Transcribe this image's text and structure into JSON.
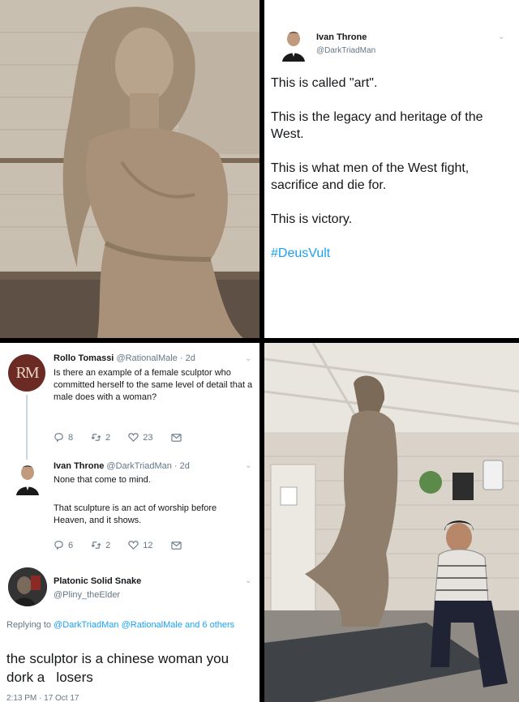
{
  "top_tweet": {
    "name": "Ivan Throne",
    "handle": "@DarkTriadMan",
    "lines": [
      "This is called \"art\".",
      "This is the legacy and heritage of the West.",
      "This is what men of the West fight, sacrifice and die for.",
      "This is victory."
    ],
    "hashtag": "#DeusVult"
  },
  "thread": {
    "rollo": {
      "avatar_text": "RM",
      "name": "Rollo Tomassi",
      "meta": "@RationalMale · 2d",
      "text": "Is there an example of a female sculptor who committed herself to the same level of detail that a male does with a woman?",
      "replies": "8",
      "retweets": "2",
      "likes": "23"
    },
    "ivan": {
      "name": "Ivan Throne",
      "meta": "@DarkTriadMan · 2d",
      "text1": "None that come to mind.",
      "text2": "That sculpture is an act of worship before Heaven, and it shows.",
      "replies": "6",
      "retweets": "2",
      "likes": "12"
    },
    "snake": {
      "name": "Platonic Solid Snake",
      "handle": "@Pliny_theElder",
      "replying_prefix": "Replying to ",
      "replying_to": "@DarkTriadMan @RationalMale and 6 others",
      "text": "the sculptor is a chinese woman you dork a   losers",
      "timestamp": "2:13 PM · 17 Oct 17"
    }
  },
  "colors": {
    "link": "#1da1f2",
    "text": "#14171a",
    "muted": "#657786",
    "rm_avatar": "#6b2a24"
  }
}
